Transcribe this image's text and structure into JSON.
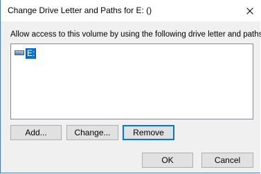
{
  "window": {
    "title": "Change Drive Letter and Paths for E: ()"
  },
  "dialog": {
    "instruction": "Allow access to this volume by using the following drive letter and paths:",
    "list_items": [
      {
        "label": "E:",
        "icon": "drive-icon",
        "selected": true
      }
    ]
  },
  "buttons": {
    "add": "Add...",
    "change": "Change...",
    "remove": "Remove",
    "ok": "OK",
    "cancel": "Cancel"
  },
  "colors": {
    "selection": "#0078d7",
    "focus_border": "#0078d7",
    "button_face": "#e1e1e1",
    "dialog_bg": "#f0f0f0"
  }
}
